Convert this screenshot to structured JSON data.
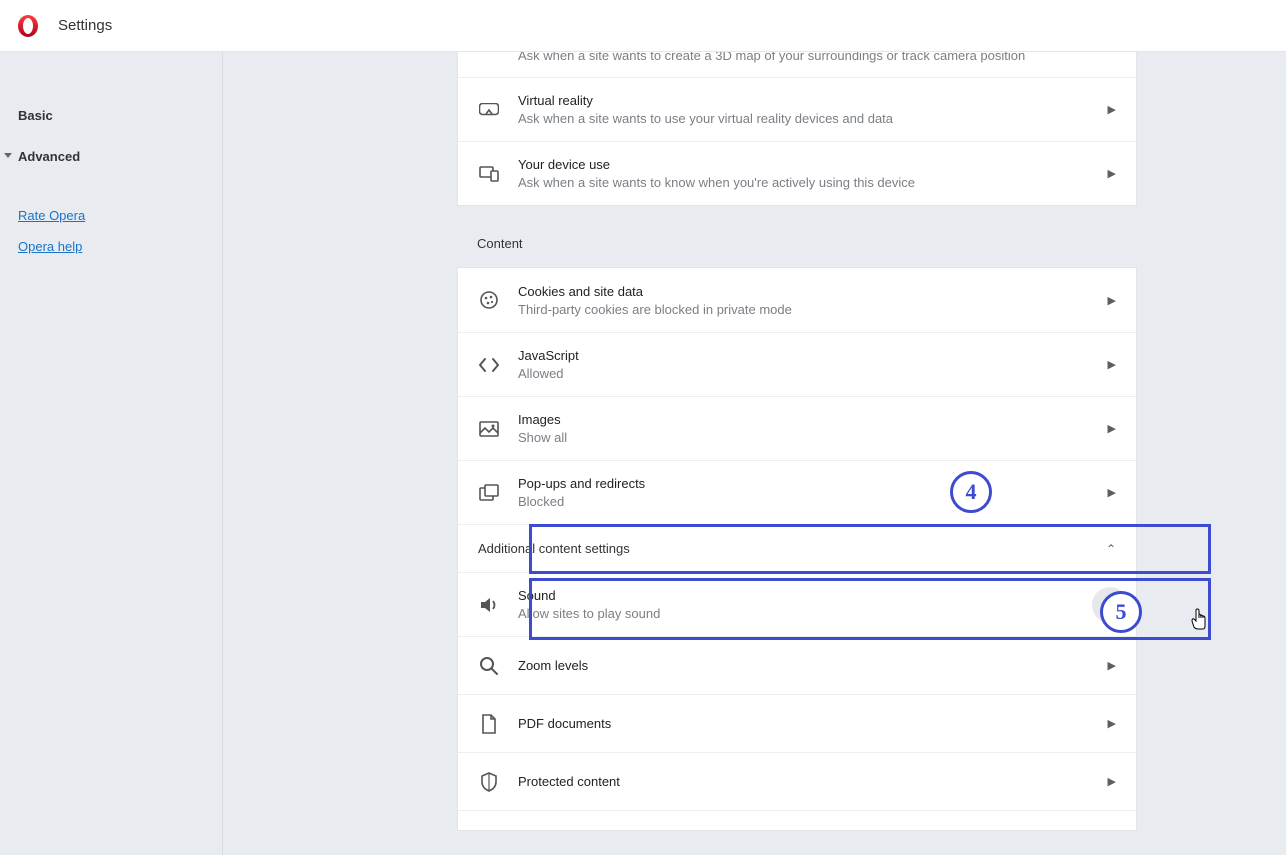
{
  "header": {
    "title": "Settings"
  },
  "sidebar": {
    "basic": "Basic",
    "advanced": "Advanced",
    "rate": "Rate Opera",
    "help": "Opera help"
  },
  "cutoff_desc": "Ask when a site wants to create a 3D map of your surroundings or track camera position",
  "perm_rows": [
    {
      "title": "Virtual reality",
      "desc": "Ask when a site wants to use your virtual reality devices and data",
      "icon": "vr"
    },
    {
      "title": "Your device use",
      "desc": "Ask when a site wants to know when you're actively using this device",
      "icon": "device"
    }
  ],
  "content_label": "Content",
  "content_rows": [
    {
      "title": "Cookies and site data",
      "desc": "Third-party cookies are blocked in private mode",
      "icon": "cookie"
    },
    {
      "title": "JavaScript",
      "desc": "Allowed",
      "icon": "code"
    },
    {
      "title": "Images",
      "desc": "Show all",
      "icon": "image"
    },
    {
      "title": "Pop-ups and redirects",
      "desc": "Blocked",
      "icon": "popup"
    }
  ],
  "expander_label": "Additional content settings",
  "addl_rows": [
    {
      "title": "Sound",
      "desc": "Allow sites to play sound",
      "icon": "sound"
    },
    {
      "title": "Zoom levels",
      "desc": "",
      "icon": "zoom"
    },
    {
      "title": "PDF documents",
      "desc": "",
      "icon": "pdf"
    },
    {
      "title": "Protected content",
      "desc": "",
      "icon": "shield"
    }
  ],
  "callouts": {
    "four": "4",
    "five": "5"
  }
}
